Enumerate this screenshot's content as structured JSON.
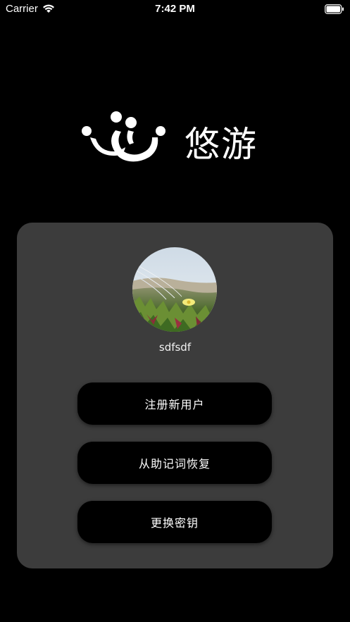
{
  "status_bar": {
    "carrier": "Carrier",
    "time": "7:42 PM",
    "icons": [
      "wifi-icon",
      "battery-icon"
    ]
  },
  "logo": {
    "text": "悠游",
    "mark_icon": "youyou-logo-mark"
  },
  "profile": {
    "username": "sdfsdf",
    "avatar": "avatar-photo-flowers"
  },
  "actions": {
    "register_label": "注册新用户",
    "recover_label": "从助记词恢复",
    "change_key_label": "更换密钥"
  },
  "colors": {
    "background": "#000000",
    "card": "#3c3c3c",
    "button": "#000000",
    "text": "#ffffff"
  }
}
